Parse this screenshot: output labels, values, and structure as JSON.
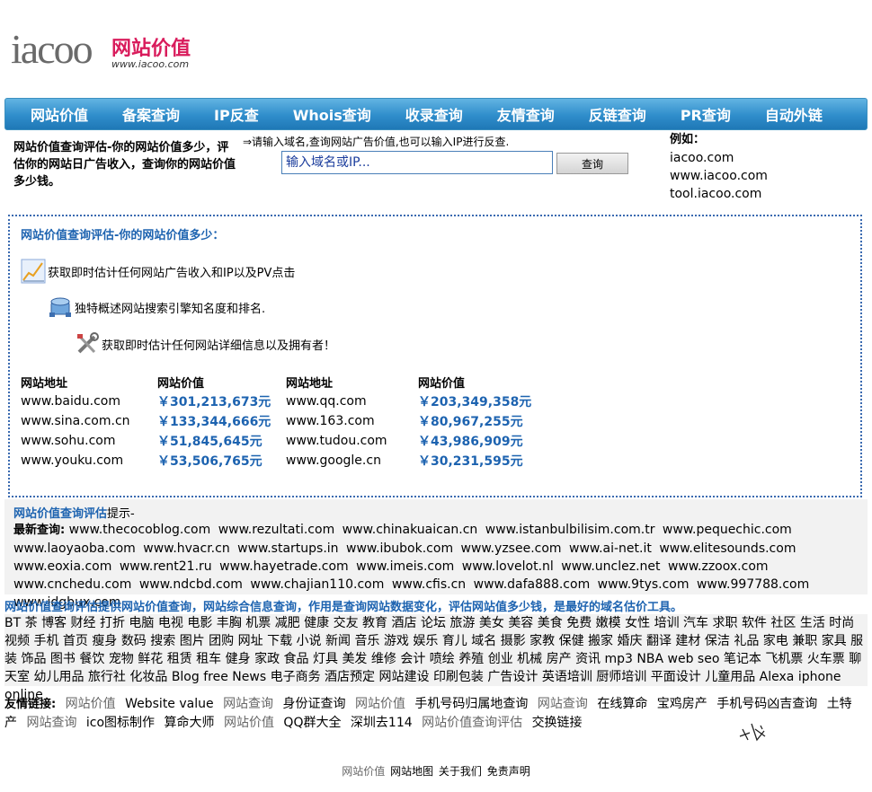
{
  "logo": {
    "mark": "iacoo",
    "cn": "网站价值",
    "url": "www.iacoo.com"
  },
  "nav": [
    "网站价值",
    "备案查询",
    "IP反查",
    "Whois查询",
    "收录查询",
    "友情查询",
    "反链查询",
    "PR查询",
    "自动外链"
  ],
  "intro": "网站价值查询评估-你的网站价值多少，评估你的网站日广告收入，查询你的网站价值多少钱。",
  "search": {
    "hint": "⇒请输入域名,查询网站广告价值,也可以输入IP进行反查.",
    "placeholder": "输入域名或IP...",
    "button": "查询"
  },
  "examples": {
    "label": "例如：",
    "items": [
      "iacoo.com",
      "www.iacoo.com",
      "tool.iacoo.com"
    ]
  },
  "main": {
    "title": "网站价值查询评估-你的网站价值多少：",
    "features": [
      "获取即时估计任何网站广告收入和IP以及PV点击",
      "独特概述网站搜索引擎知名度和排名.",
      "获取即时估计任何网站详细信息以及拥有者！"
    ],
    "headers": [
      "网站地址",
      "网站价值",
      "网站地址",
      "网站价值"
    ],
    "rows": [
      [
        "www.baidu.com",
        "￥301,213,673元",
        "www.qq.com",
        "￥203,349,358元"
      ],
      [
        "www.sina.com.cn",
        "￥133,344,666元",
        "www.163.com",
        "￥80,967,255元"
      ],
      [
        "www.sohu.com",
        "￥51,845,645元",
        "www.tudou.com",
        "￥43,986,909元"
      ],
      [
        "www.youku.com",
        "￥53,506,765元",
        "www.google.cn",
        "￥30,231,595元"
      ]
    ]
  },
  "info": {
    "title_bold": "网站价值查询评估",
    "title_rest": "提示-",
    "recent_label": "最新查询:",
    "recent": [
      "www.thecocoblog.com",
      "www.rezultati.com",
      "www.chinakuaican.cn",
      "www.istanbulbilisim.com.tr",
      "www.pequechic.com",
      "www.laoyaoba.com",
      "www.hvacr.cn",
      "www.startups.in",
      "www.ibubok.com",
      "www.yzsee.com",
      "www.ai-net.it",
      "www.elitesounds.com",
      "www.eoxia.com",
      "www.rent21.ru",
      "www.hayetrade.com",
      "www.imeis.com",
      "www.lovelot.nl",
      "www.unclez.net",
      "www.zzoox.com",
      "www.cnchedu.com",
      "www.ndcbd.com",
      "www.chajian110.com",
      "www.cfis.cn",
      "www.dafa888.com",
      "www.9tys.com",
      "www.997788.com",
      "www.idgbux.com"
    ]
  },
  "desc": "网站价值查询评估提供网站价值查询，网站综合信息查询，作用是查询网站数据变化，评估网站值多少钱，是最好的域名估价工具。",
  "tags": [
    "BT",
    "茶",
    "博客",
    "财经",
    "打折",
    "电脑",
    "电视",
    "电影",
    "丰胸",
    "机票",
    "减肥",
    "健康",
    "交友",
    "教育",
    "酒店",
    "论坛",
    "旅游",
    "美女",
    "美容",
    "美食",
    "免费",
    "嫩模",
    "女性",
    "培训",
    "汽车",
    "求职",
    "软件",
    "社区",
    "生活",
    "时尚",
    "视频",
    "手机",
    "首页",
    "瘦身",
    "数码",
    "搜索",
    "图片",
    "团购",
    "网址",
    "下载",
    "小说",
    "新闻",
    "音乐",
    "游戏",
    "娱乐",
    "育儿",
    "域名",
    "摄影",
    "家教",
    "保健",
    "搬家",
    "婚庆",
    "翻译",
    "建材",
    "保洁",
    "礼品",
    "家电",
    "兼职",
    "家具",
    "服装",
    "饰品",
    "图书",
    "餐饮",
    "宠物",
    "鲜花",
    "租赁",
    "租车",
    "健身",
    "家政",
    "食品",
    "灯具",
    "美发",
    "维修",
    "会计",
    "喷绘",
    "养殖",
    "创业",
    "机械",
    "房产",
    "资讯",
    "mp3",
    "NBA",
    "web",
    "seo",
    "笔记本",
    "飞机票",
    "火车票",
    "聊天室",
    "幼儿用品",
    "旅行社",
    "化妆品",
    "Blog",
    "free",
    "News",
    "电子商务",
    "酒店预定",
    "网站建设",
    "印刷包装",
    "广告设计",
    "英语培训",
    "厨师培训",
    "平面设计",
    "儿童用品",
    "Alexa",
    "iphone",
    "online"
  ],
  "friends": {
    "label": "友情链接:",
    "items": [
      {
        "t": "网站价值",
        "g": true
      },
      {
        "t": "Website value",
        "g": false
      },
      {
        "t": "网站查询",
        "g": true
      },
      {
        "t": "身份证查询",
        "g": false
      },
      {
        "t": "网站价值",
        "g": true
      },
      {
        "t": "手机号码归属地查询",
        "g": false
      },
      {
        "t": "网站查询",
        "g": true
      },
      {
        "t": "在线算命",
        "g": false
      },
      {
        "t": "宝鸡房产",
        "g": false
      },
      {
        "t": "手机号码凶吉查询",
        "g": false
      },
      {
        "t": "土特产",
        "g": false
      },
      {
        "t": "网站查询",
        "g": true
      },
      {
        "t": "ico图标制作",
        "g": false
      },
      {
        "t": "算命大师",
        "g": false
      },
      {
        "t": "网站价值",
        "g": true
      },
      {
        "t": "QQ群大全",
        "g": false
      },
      {
        "t": "深圳去114",
        "g": false
      },
      {
        "t": "网站价值查询评估",
        "g": true
      },
      {
        "t": "交换链接",
        "g": false
      }
    ]
  },
  "footer": {
    "brand": "网站价值",
    "links": [
      "网站地图",
      "关于我们",
      "免责声明"
    ]
  },
  "colors": {
    "accent": "#1d63b0",
    "nav": "#2f8dcb",
    "logo": "#d91c5c"
  }
}
